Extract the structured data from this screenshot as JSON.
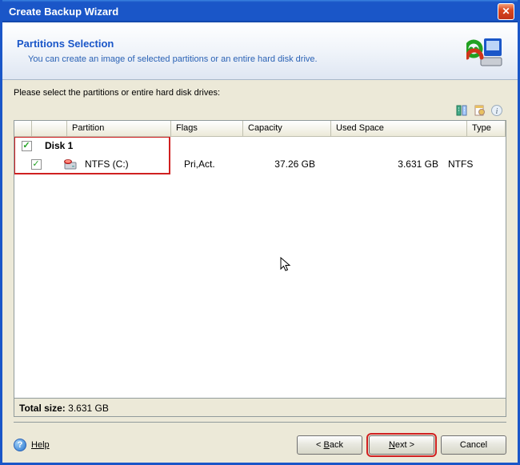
{
  "window": {
    "title": "Create Backup Wizard"
  },
  "header": {
    "title": "Partitions Selection",
    "subtitle": "You can create an image of selected partitions or an entire hard disk drive."
  },
  "content": {
    "instruction": "Please select the partitions or entire hard disk drives:"
  },
  "columns": {
    "partition": "Partition",
    "flags": "Flags",
    "capacity": "Capacity",
    "used": "Used Space",
    "type": "Type"
  },
  "disk": {
    "checked": true,
    "label": "Disk 1",
    "partitions": [
      {
        "checked": true,
        "name": "NTFS (C:)",
        "flags": "Pri,Act.",
        "capacity": "37.26 GB",
        "used": "3.631 GB",
        "type": "NTFS"
      }
    ]
  },
  "total": {
    "label": "Total size:",
    "value": "3.631 GB"
  },
  "buttons": {
    "help": "Help",
    "back": "< Back",
    "next": "Next >",
    "cancel": "Cancel"
  }
}
